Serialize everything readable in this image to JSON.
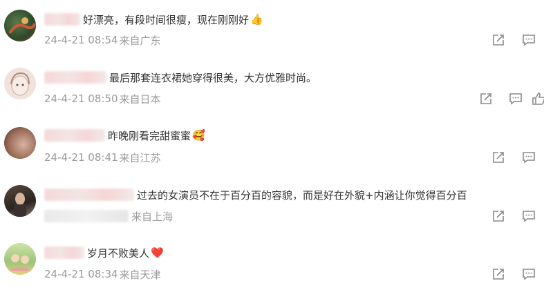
{
  "comments": [
    {
      "text": "好漂亮，有段时间很瘦，现在刚刚好",
      "emoji": "👍",
      "date": "24-4-21 08:54",
      "location": "来自广东"
    },
    {
      "text": "最后那套连衣裙她穿得很美，大方优雅时尚。",
      "emoji": "",
      "date": "24-4-21 08:50",
      "location": "来自日本"
    },
    {
      "text": "昨晚刚看完甜蜜蜜",
      "emoji": "🥰",
      "date": "24-4-21 08:41",
      "location": "来自江苏"
    },
    {
      "text": "过去的女演员不在于百分百的容貌，而是好在外貌+内涵让你觉得百分百",
      "emoji": "",
      "date": "",
      "location": "来自上海"
    },
    {
      "text": "岁月不败美人",
      "emoji": "❤️",
      "date": "24-4-21 08:34",
      "location": "来自天津"
    }
  ],
  "icons": {
    "share": "share-icon",
    "reply": "comment-icon",
    "like": "thumbs-up-icon"
  }
}
